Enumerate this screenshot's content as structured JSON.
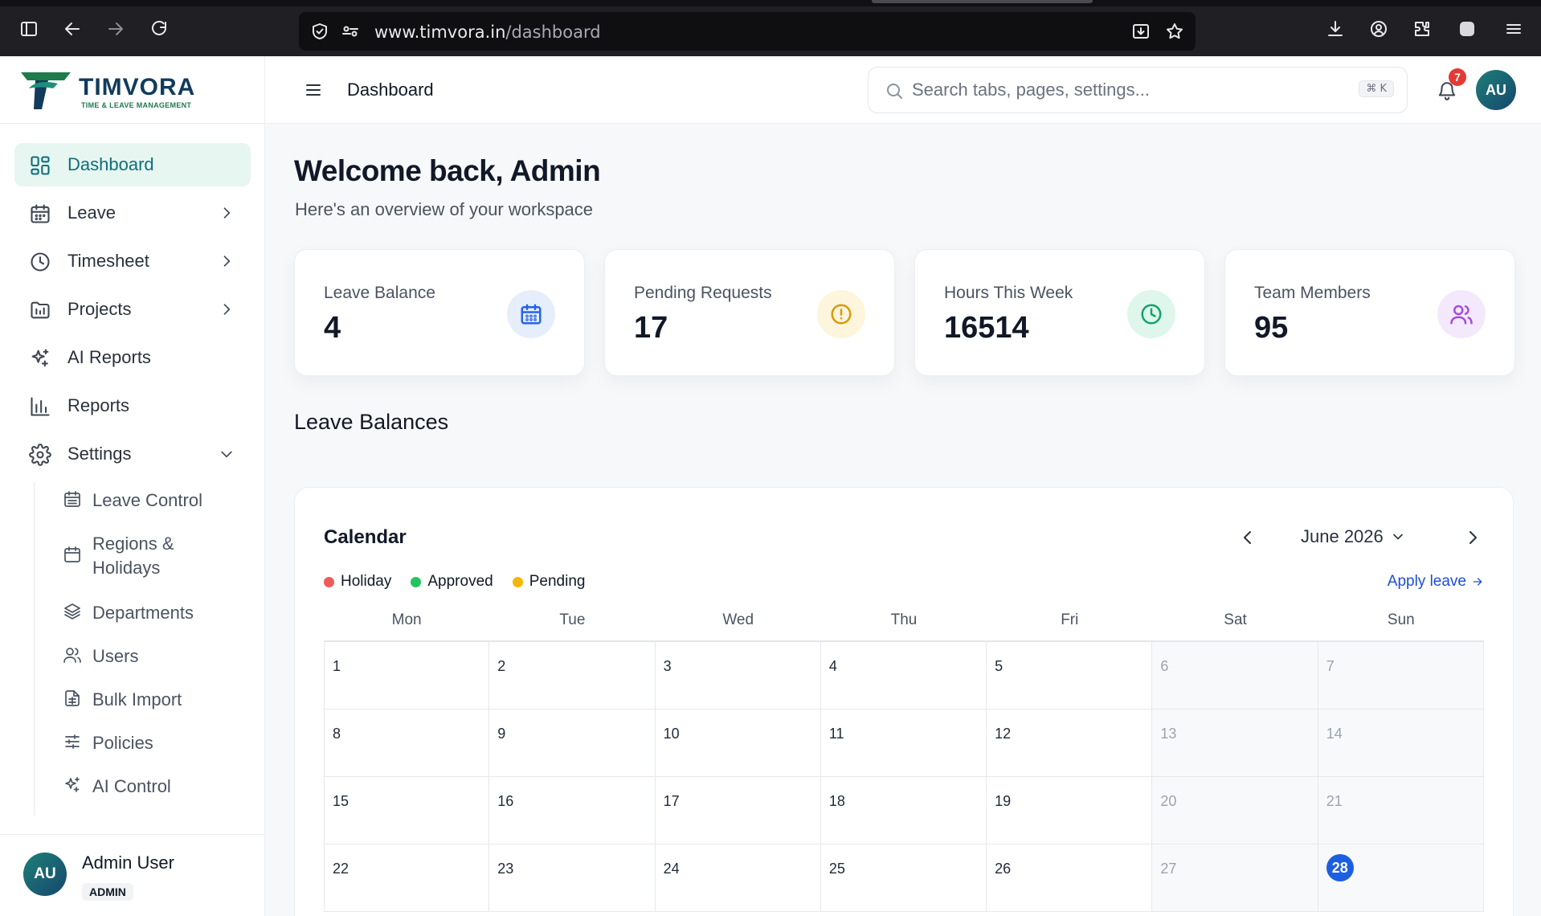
{
  "browser": {
    "url_host": "www.timvora.in",
    "url_path": "/dashboard"
  },
  "brand": {
    "name": "TIMVORA",
    "tagline": "TIME & LEAVE MANAGEMENT"
  },
  "sidebar": {
    "items": [
      {
        "label": "Dashboard",
        "icon": "grid-icon",
        "active": true
      },
      {
        "label": "Leave",
        "icon": "calendar-icon"
      },
      {
        "label": "Timesheet",
        "icon": "clock-icon"
      },
      {
        "label": "Projects",
        "icon": "folder-chart-icon"
      },
      {
        "label": "AI Reports",
        "icon": "sparkles-icon"
      },
      {
        "label": "Reports",
        "icon": "bar-chart-icon"
      },
      {
        "label": "Settings",
        "icon": "gear-icon"
      }
    ],
    "settings_sub": [
      {
        "label": "Leave Control"
      },
      {
        "label": "Regions & Holidays"
      },
      {
        "label": "Departments"
      },
      {
        "label": "Users"
      },
      {
        "label": "Bulk Import"
      },
      {
        "label": "Policies"
      },
      {
        "label": "AI Control"
      }
    ],
    "user": {
      "initials": "AU",
      "name": "Admin User",
      "role": "ADMIN"
    }
  },
  "topbar": {
    "title": "Dashboard",
    "search_placeholder": "Search tabs, pages, settings...",
    "search_shortcut": "⌘ K",
    "notification_count": "7",
    "avatar_initials": "AU"
  },
  "main": {
    "welcome": "Welcome back, Admin",
    "subtitle": "Here's an overview of your workspace",
    "stats": [
      {
        "label": "Leave Balance",
        "value": "4",
        "icon": "calendar-icon",
        "color": "#2563eb",
        "bg": "#e6eefc"
      },
      {
        "label": "Pending Requests",
        "value": "17",
        "icon": "alert-circle-icon",
        "color": "#d99a06",
        "bg": "#fdf5dc"
      },
      {
        "label": "Hours This Week",
        "value": "16514",
        "icon": "clock-icon",
        "color": "#10a36b",
        "bg": "#dff6ec"
      },
      {
        "label": "Team Members",
        "value": "95",
        "icon": "users-icon",
        "color": "#a24be0",
        "bg": "#f4e9fc"
      }
    ],
    "section_title": "Leave Balances"
  },
  "calendar": {
    "title": "Calendar",
    "month": "June 2026",
    "legend": [
      {
        "label": "Holiday",
        "color": "#ef5b5b"
      },
      {
        "label": "Approved",
        "color": "#22c55e"
      },
      {
        "label": "Pending",
        "color": "#f5b50a"
      }
    ],
    "apply_label": "Apply leave",
    "weekdays": [
      "Mon",
      "Tue",
      "Wed",
      "Thu",
      "Fri",
      "Sat",
      "Sun"
    ],
    "weeks": [
      [
        "1",
        "2",
        "3",
        "4",
        "5",
        "6",
        "7"
      ],
      [
        "8",
        "9",
        "10",
        "11",
        "12",
        "13",
        "14"
      ],
      [
        "15",
        "16",
        "17",
        "18",
        "19",
        "20",
        "21"
      ],
      [
        "22",
        "23",
        "24",
        "25",
        "26",
        "27",
        "28"
      ]
    ],
    "today": "28"
  }
}
